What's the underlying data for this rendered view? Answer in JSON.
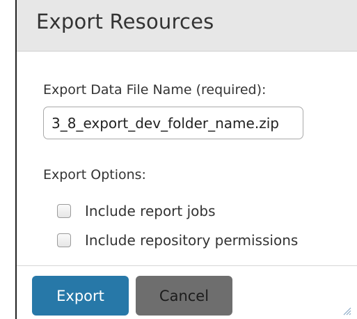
{
  "dialog": {
    "title": "Export Resources",
    "filename": {
      "label": "Export Data File Name (required):",
      "value": "3_8_export_dev_folder_name.zip"
    },
    "options": {
      "label": "Export Options:",
      "items": [
        {
          "label": "Include report jobs",
          "checked": false
        },
        {
          "label": "Include repository permissions",
          "checked": false
        }
      ]
    },
    "buttons": {
      "export_label": "Export",
      "cancel_label": "Cancel"
    }
  },
  "colors": {
    "title_bar": "#e7e7e7",
    "export_button": "#2778a8",
    "cancel_button": "#6e6e6e",
    "resize_handle": "#8aa9c6"
  },
  "icons": {
    "resize": "resize-grip-icon",
    "checkbox": "checkbox-icon"
  }
}
